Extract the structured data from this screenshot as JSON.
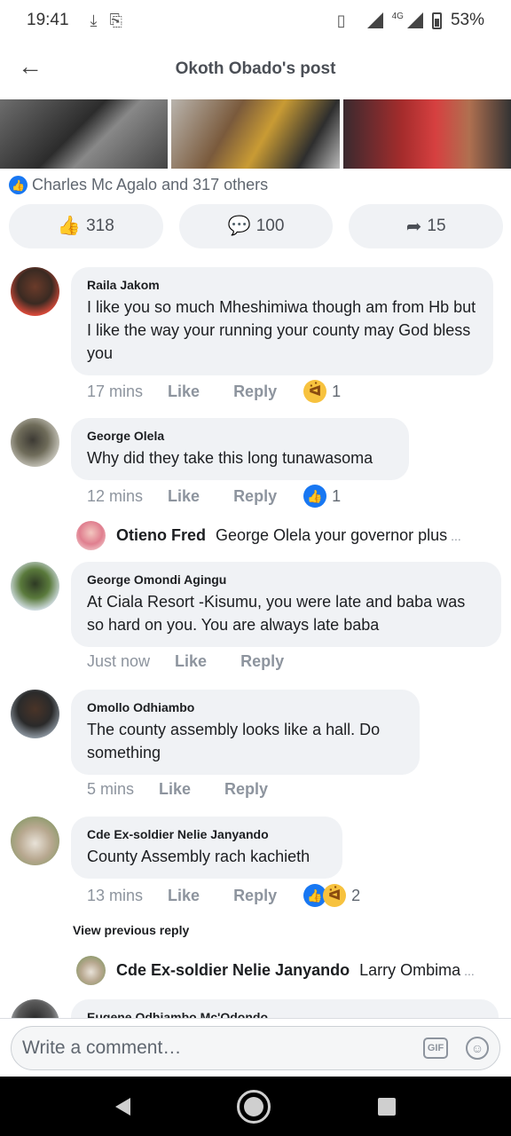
{
  "status_bar": {
    "time": "19:41",
    "network": "4G",
    "battery": "53%"
  },
  "header": {
    "title": "Okoth Obado's post",
    "back_icon": "arrow-left-icon"
  },
  "likes_summary": "Charles Mc Agalo and 317 others",
  "actions": {
    "likes": "318",
    "comments": "100",
    "shares": "15"
  },
  "comments": [
    {
      "author": "Raila Jakom",
      "text": "I like you so much Mheshimiwa though am from Hb but I like the way your running your county may God bless you",
      "time": "17 mins",
      "like_label": "Like",
      "reply_label": "Reply",
      "reaction_count": "1",
      "reaction": "haha"
    },
    {
      "author": "George Olela",
      "text": "Why did they take this long tunawasoma",
      "time": "12 mins",
      "like_label": "Like",
      "reply_label": "Reply",
      "reaction_count": "1",
      "reaction": "like"
    },
    {
      "author": "George Omondi Agingu",
      "text": "At Ciala Resort -Kisumu, you were late and baba was so hard on you. You are always late baba",
      "time": "Just now",
      "like_label": "Like",
      "reply_label": "Reply"
    },
    {
      "author": "Omollo Odhiambo",
      "text": "The county assembly looks like a hall.  Do something",
      "time": "5 mins",
      "like_label": "Like",
      "reply_label": "Reply"
    },
    {
      "author": "Cde Ex-soldier Nelie Janyando",
      "text": "County Assembly rach kachieth",
      "time": "13 mins",
      "like_label": "Like",
      "reply_label": "Reply",
      "reaction_count": "2",
      "reaction": "like+haha"
    },
    {
      "author": "Eugene Odhiambo Mc'Odondo"
    }
  ],
  "replies": [
    {
      "author": "Otieno Fred",
      "text": "George Olela your governor plus",
      "ellipsis": "..."
    },
    {
      "author": "Cde Ex-soldier Nelie Janyando",
      "text": "Larry Ombima",
      "ellipsis": "..."
    }
  ],
  "view_previous_reply": "View previous reply",
  "composer": {
    "placeholder": "Write a comment…",
    "gif_label": "GIF"
  },
  "colors": {
    "facebook_blue": "#1877f2",
    "bubble_bg": "#f0f2f5",
    "meta_gray": "#8d949e"
  }
}
